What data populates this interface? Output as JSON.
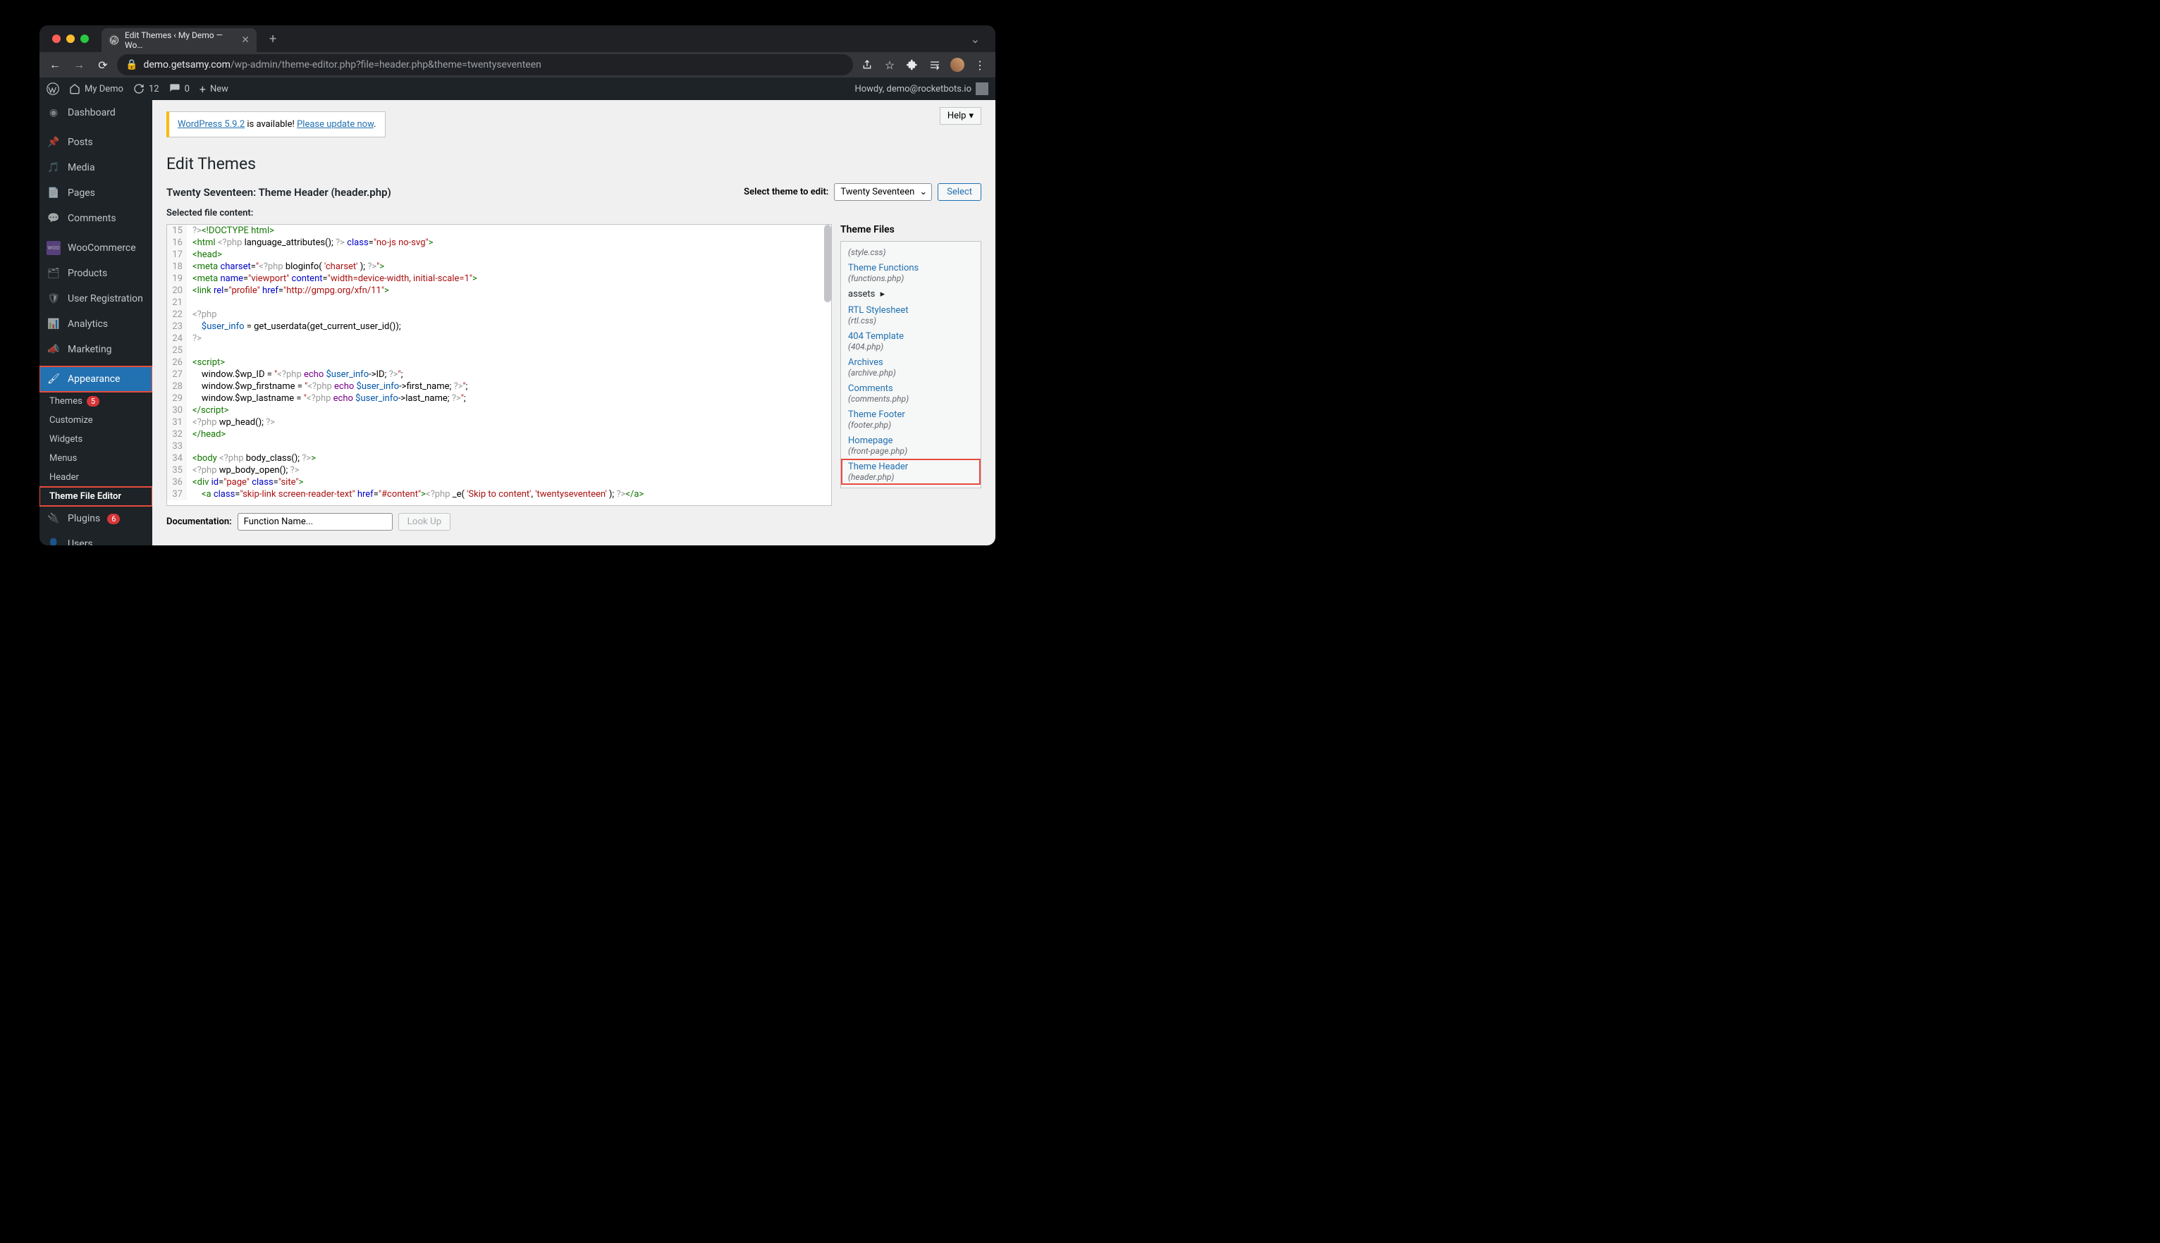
{
  "browser": {
    "tab_title": "Edit Themes ‹ My Demo — Wo…",
    "url_host": "demo.getsamy.com",
    "url_path": "/wp-admin/theme-editor.php?file=header.php&theme=twentyseventeen"
  },
  "adminbar": {
    "site_name": "My Demo",
    "updates": "12",
    "comments": "0",
    "new_label": "New",
    "howdy": "Howdy, demo@rocketbots.io"
  },
  "sidebar": {
    "dashboard": "Dashboard",
    "posts": "Posts",
    "media": "Media",
    "pages": "Pages",
    "comments": "Comments",
    "woocommerce": "WooCommerce",
    "products": "Products",
    "user_registration": "User Registration",
    "analytics": "Analytics",
    "marketing": "Marketing",
    "appearance": "Appearance",
    "appearance_subs": {
      "themes": "Themes",
      "themes_badge": "5",
      "customize": "Customize",
      "widgets": "Widgets",
      "menus": "Menus",
      "header": "Header",
      "theme_file_editor": "Theme File Editor"
    },
    "plugins": "Plugins",
    "plugins_badge": "6",
    "users": "Users"
  },
  "main": {
    "help": "Help",
    "notice_link1": "WordPress 5.9.2",
    "notice_text1": " is available! ",
    "notice_link2": "Please update now",
    "notice_dot": ".",
    "title": "Edit Themes",
    "subheading": "Twenty Seventeen: Theme Header (header.php)",
    "select_label": "Select theme to edit:",
    "theme_selected": "Twenty Seventeen",
    "select_btn": "Select",
    "content_label": "Selected file content:",
    "files_heading": "Theme Files",
    "doc_label": "Documentation:",
    "doc_placeholder": "Function Name...",
    "lookup": "Look Up"
  },
  "theme_files": [
    {
      "name": "",
      "desc": "(style.css)"
    },
    {
      "name": "Theme Functions",
      "desc": "(functions.php)"
    },
    {
      "name": "assets",
      "desc": "",
      "folder": true
    },
    {
      "name": "RTL Stylesheet",
      "desc": "(rtl.css)"
    },
    {
      "name": "404 Template",
      "desc": "(404.php)"
    },
    {
      "name": "Archives",
      "desc": "(archive.php)"
    },
    {
      "name": "Comments",
      "desc": "(comments.php)"
    },
    {
      "name": "Theme Footer",
      "desc": "(footer.php)"
    },
    {
      "name": "Homepage",
      "desc": "(front-page.php)"
    },
    {
      "name": "Theme Header",
      "desc": "(header.php)",
      "active": true
    }
  ],
  "code_lines": [
    {
      "n": 15,
      "html": "<span class='php'>?&gt;</span><span class='tag'>&lt;!DOCTYPE html&gt;</span>"
    },
    {
      "n": 16,
      "html": "<span class='tag'>&lt;html</span> <span class='php'>&lt;?php</span> <span>language_attributes();</span> <span class='php'>?&gt;</span> <span class='attr'>class</span>=<span class='str'>\"no-js no-svg\"</span><span class='tag'>&gt;</span>"
    },
    {
      "n": 17,
      "html": "<span class='tag'>&lt;head&gt;</span>"
    },
    {
      "n": 18,
      "html": "<span class='tag'>&lt;meta</span> <span class='attr'>charset</span>=<span class='str'>\"</span><span class='php'>&lt;?php</span> <span>bloginfo(</span> <span class='str'>'charset'</span> <span>);</span> <span class='php'>?&gt;</span><span class='str'>\"</span><span class='tag'>&gt;</span>"
    },
    {
      "n": 19,
      "html": "<span class='tag'>&lt;meta</span> <span class='attr'>name</span>=<span class='str'>\"viewport\"</span> <span class='attr'>content</span>=<span class='str'>\"width=device-width, initial-scale=1\"</span><span class='tag'>&gt;</span>"
    },
    {
      "n": 20,
      "html": "<span class='tag'>&lt;link</span> <span class='attr'>rel</span>=<span class='str'>\"profile\"</span> <span class='attr'>href</span>=<span class='str'>\"http://gmpg.org/xfn/11\"</span><span class='tag'>&gt;</span>"
    },
    {
      "n": 21,
      "html": ""
    },
    {
      "n": 22,
      "html": "<span class='php'>&lt;?php</span>"
    },
    {
      "n": 23,
      "html": "    <span class='var'>$user_info</span> = get_userdata(get_current_user_id());"
    },
    {
      "n": 24,
      "html": "<span class='php'>?&gt;</span>"
    },
    {
      "n": 25,
      "html": ""
    },
    {
      "n": 26,
      "html": "<span class='tag'>&lt;script&gt;</span>"
    },
    {
      "n": 27,
      "html": "    window.$wp_ID = <span class='str'>\"</span><span class='php'>&lt;?php</span> <span class='kw'>echo</span> <span class='var'>$user_info</span>-&gt;ID; <span class='php'>?&gt;</span><span class='str'>\"</span>;"
    },
    {
      "n": 28,
      "html": "    window.$wp_firstname = <span class='str'>\"</span><span class='php'>&lt;?php</span> <span class='kw'>echo</span> <span class='var'>$user_info</span>-&gt;first_name; <span class='php'>?&gt;</span><span class='str'>\"</span>;"
    },
    {
      "n": 29,
      "html": "    window.$wp_lastname = <span class='str'>\"</span><span class='php'>&lt;?php</span> <span class='kw'>echo</span> <span class='var'>$user_info</span>-&gt;last_name; <span class='php'>?&gt;</span><span class='str'>\"</span>;"
    },
    {
      "n": 30,
      "html": "<span class='tag'>&lt;/script&gt;</span>"
    },
    {
      "n": 31,
      "html": "<span class='php'>&lt;?php</span> wp_head(); <span class='php'>?&gt;</span>"
    },
    {
      "n": 32,
      "html": "<span class='tag'>&lt;/head&gt;</span>"
    },
    {
      "n": 33,
      "html": ""
    },
    {
      "n": 34,
      "html": "<span class='tag'>&lt;body</span> <span class='php'>&lt;?php</span> body_class(); <span class='php'>?&gt;</span><span class='tag'>&gt;</span>"
    },
    {
      "n": 35,
      "html": "<span class='php'>&lt;?php</span> wp_body_open(); <span class='php'>?&gt;</span>"
    },
    {
      "n": 36,
      "html": "<span class='tag'>&lt;div</span> <span class='attr'>id</span>=<span class='str'>\"page\"</span> <span class='attr'>class</span>=<span class='str'>\"site\"</span><span class='tag'>&gt;</span>"
    },
    {
      "n": 37,
      "html": "    <span class='tag'>&lt;a</span> <span class='attr'>class</span>=<span class='str'>\"skip-link screen-reader-text\"</span> <span class='attr'>href</span>=<span class='str'>\"#content\"</span><span class='tag'>&gt;</span><span class='php'>&lt;?php</span> _e( <span class='str'>'Skip to content'</span>, <span class='str'>'twentyseventeen'</span> ); <span class='php'>?&gt;</span><span class='tag'>&lt;/a&gt;</span>"
    }
  ]
}
